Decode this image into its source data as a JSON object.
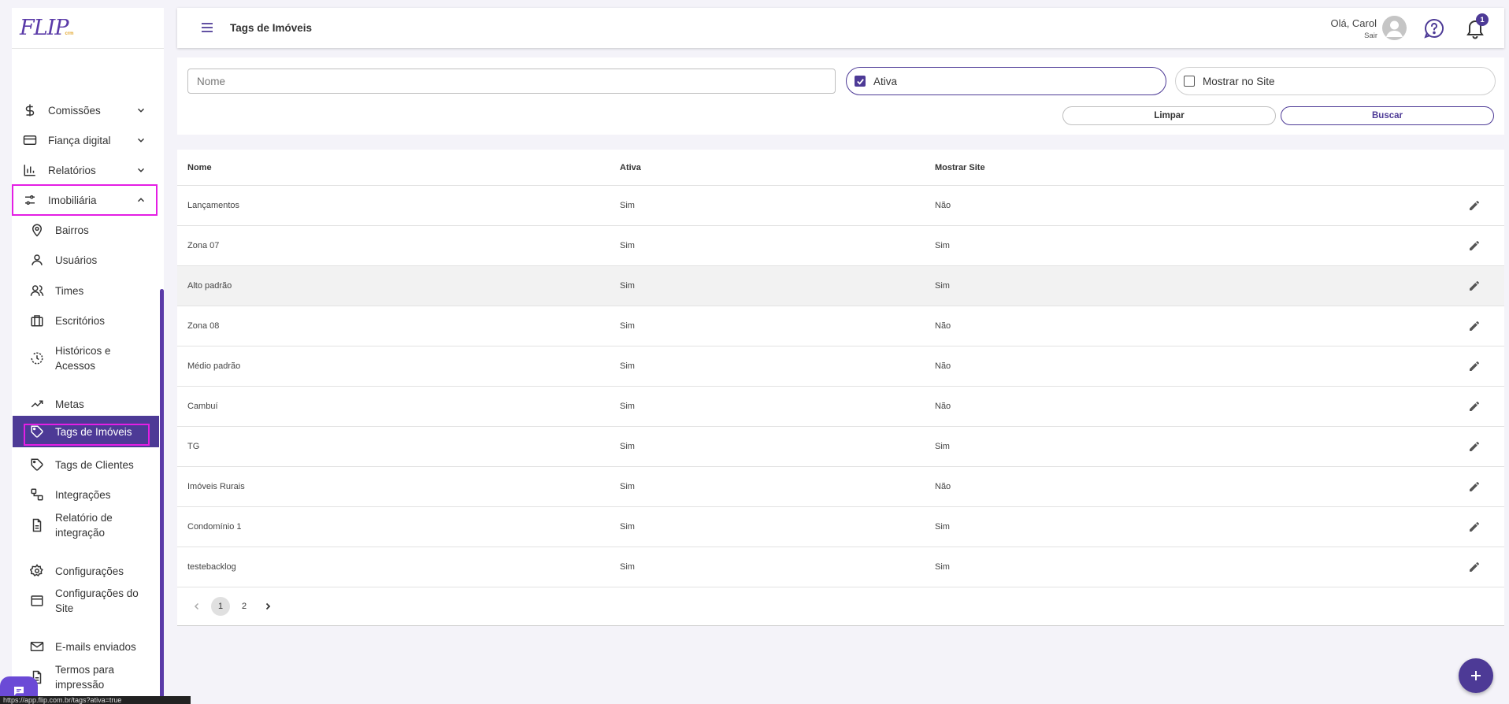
{
  "app": {
    "logo_text": "FLIP",
    "logo_sub": "crm"
  },
  "sidebar": {
    "main_items": [
      {
        "label": "Comissões",
        "icon": "dollar-icon"
      },
      {
        "label": "Fiança digital",
        "icon": "credit-card-icon"
      },
      {
        "label": "Relatórios",
        "icon": "bar-chart-icon"
      },
      {
        "label": "Imobiliária",
        "icon": "sliders-icon"
      }
    ],
    "sub_items": [
      {
        "label": "Bairros",
        "icon": "map-pin-icon"
      },
      {
        "label": "Usuários",
        "icon": "user-icon"
      },
      {
        "label": "Times",
        "icon": "users-icon"
      },
      {
        "label": "Escritórios",
        "icon": "briefcase-icon"
      },
      {
        "label": "Históricos e Acessos",
        "icon": "history-icon"
      },
      {
        "label": "Metas",
        "icon": "trending-up-icon"
      },
      {
        "label": "Tags de Imóveis",
        "icon": "tag-icon"
      },
      {
        "label": "Tags de Clientes",
        "icon": "tag-icon"
      },
      {
        "label": "Integrações",
        "icon": "integration-icon"
      },
      {
        "label": "Relatório de integração",
        "icon": "document-icon"
      },
      {
        "label": "Configurações",
        "icon": "gear-icon"
      },
      {
        "label": "Configurações do Site",
        "icon": "browser-window-icon"
      },
      {
        "label": "E-mails enviados",
        "icon": "mail-icon"
      },
      {
        "label": "Termos para impressão",
        "icon": "document-icon"
      }
    ],
    "active_item": "Tags de Imóveis",
    "status_url": "https://app.flip.com.br/tags?ativa=true"
  },
  "header": {
    "title": "Tags de Imóveis",
    "greeting": "Olá, Carol",
    "logout": "Sair",
    "notification_count": "1"
  },
  "filters": {
    "name_placeholder": "Nome",
    "ativa_label": "Ativa",
    "ativa_checked": true,
    "mostrar_site_label": "Mostrar no Site",
    "mostrar_site_checked": false,
    "clear_label": "Limpar",
    "search_label": "Buscar"
  },
  "table": {
    "columns": [
      "Nome",
      "Ativa",
      "Mostrar Site"
    ],
    "rows": [
      {
        "nome": "Lançamentos",
        "ativa": "Sim",
        "site": "Não"
      },
      {
        "nome": "Zona 07",
        "ativa": "Sim",
        "site": "Sim"
      },
      {
        "nome": "Alto padrão",
        "ativa": "Sim",
        "site": "Sim"
      },
      {
        "nome": "Zona 08",
        "ativa": "Sim",
        "site": "Não"
      },
      {
        "nome": "Médio padrão",
        "ativa": "Sim",
        "site": "Não"
      },
      {
        "nome": "Cambuí",
        "ativa": "Sim",
        "site": "Não"
      },
      {
        "nome": "TG",
        "ativa": "Sim",
        "site": "Sim"
      },
      {
        "nome": "Imóveis Rurais",
        "ativa": "Sim",
        "site": "Não"
      },
      {
        "nome": "Condomínio 1",
        "ativa": "Sim",
        "site": "Sim"
      },
      {
        "nome": "testebacklog",
        "ativa": "Sim",
        "site": "Sim"
      }
    ]
  },
  "pagination": {
    "pages": [
      "1",
      "2"
    ],
    "current": "1"
  },
  "colors": {
    "primary": "#4d3a96",
    "highlight": "#e41ee4",
    "background": "#f4f3f9"
  }
}
